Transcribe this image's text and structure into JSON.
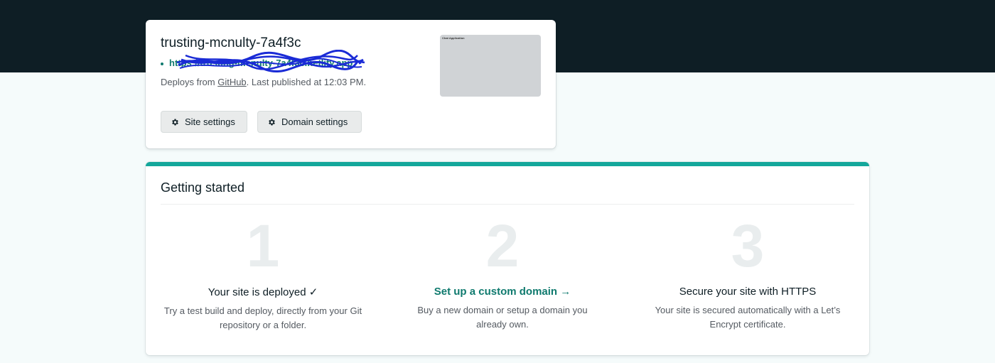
{
  "site": {
    "name": "trusting-mcnulty-7a4f3c",
    "url": "https://trusting-mcnulty-7a4f3c.netlify.app",
    "deploy_prefix": "Deploys from ",
    "deploy_source": "GitHub",
    "deploy_suffix": ". Last published at 12:03 PM.",
    "preview_title": "Chat Application",
    "buttons": {
      "site_settings": "Site settings",
      "domain_settings": "Domain settings"
    }
  },
  "getting_started": {
    "title": "Getting started",
    "steps": [
      {
        "number": "1",
        "heading": "Your site is deployed ✓",
        "description": "Try a test build and deploy, directly from your Git repository or a folder."
      },
      {
        "number": "2",
        "heading": "Set up a custom domain →",
        "description": "Buy a new domain or setup a domain you already own."
      },
      {
        "number": "3",
        "heading": "Secure your site with HTTPS",
        "description": "Your site is secured automatically with a Let’s Encrypt certificate."
      }
    ]
  },
  "colors": {
    "accent": "#14a79b",
    "link": "#0f7a6e",
    "header": "#0e1e25",
    "scribble": "#1a2bd6"
  },
  "icons": {
    "button_icon": "gear-icon"
  }
}
